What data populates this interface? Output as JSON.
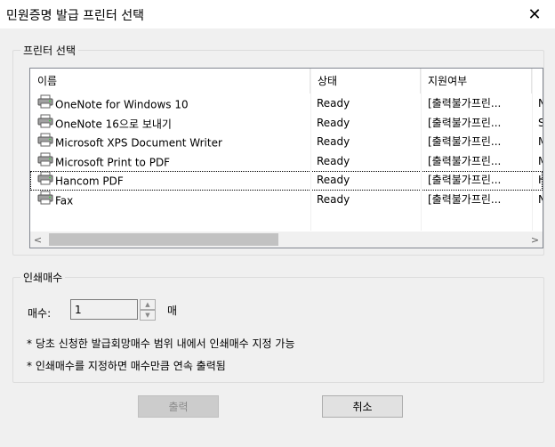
{
  "window": {
    "title": "민원증명 발급 프린터 선택",
    "close_glyph": "✕"
  },
  "printer_group": {
    "legend": "프린터 선택",
    "columns": [
      "이름",
      "상태",
      "지원여부",
      ""
    ],
    "rows": [
      {
        "name": "OneNote for Windows 10",
        "status": "Ready",
        "support": "[출력불가프린...",
        "extra": "N"
      },
      {
        "name": "OneNote 16으로 보내기",
        "status": "Ready",
        "support": "[출력불가프린...",
        "extra": "S"
      },
      {
        "name": "Microsoft XPS Document Writer",
        "status": "Ready",
        "support": "[출력불가프린...",
        "extra": "M"
      },
      {
        "name": "Microsoft Print to PDF",
        "status": "Ready",
        "support": "[출력불가프린...",
        "extra": "M"
      },
      {
        "name": "Hancom PDF",
        "status": "Ready",
        "support": "[출력불가프린...",
        "extra": "H"
      },
      {
        "name": "Fax",
        "status": "Ready",
        "support": "[출력불가프린...",
        "extra": "N"
      }
    ],
    "scroll_left": "<",
    "scroll_right": ">"
  },
  "copies_group": {
    "legend": "인쇄매수",
    "label": "매수:",
    "value": "1",
    "unit": "매",
    "spin_up": "▲",
    "spin_down": "▼",
    "note1": "* 당초 신청한 발급회망매수 범위 내에서 인쇄매수 지정 가능",
    "note2": "* 인쇄매수를 지정하면 매수만큼 연속 출력됨"
  },
  "buttons": {
    "print": "출력",
    "cancel": "취소"
  }
}
